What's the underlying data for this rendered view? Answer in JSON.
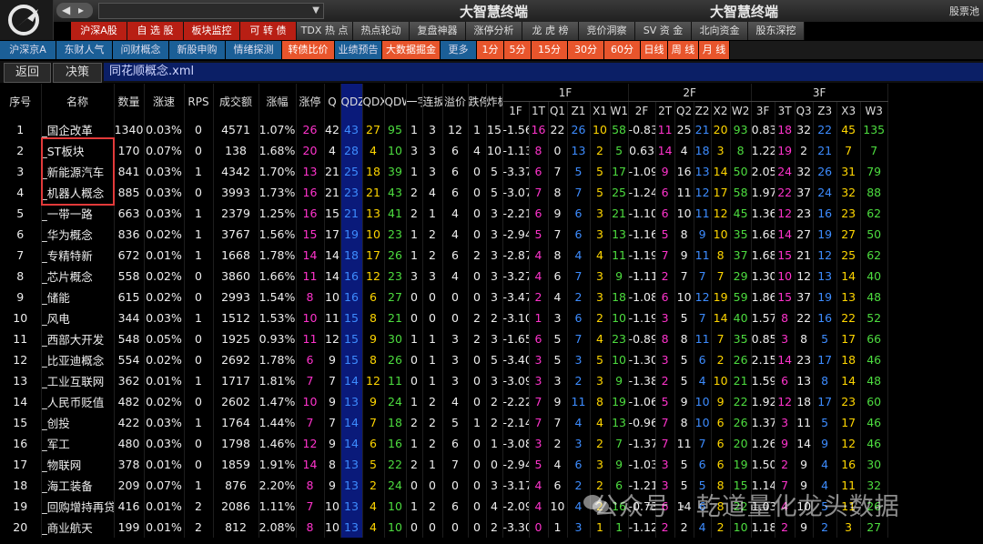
{
  "window": {
    "title_left": "大智慧终端",
    "title_right": "大智慧终端",
    "right_link": "股票池",
    "nav_arrows": "◀▸"
  },
  "main_menu": [
    {
      "label": "沪深A股",
      "style": "red"
    },
    {
      "label": "自 选 股",
      "style": "red"
    },
    {
      "label": "板块监控",
      "style": "red"
    },
    {
      "label": "可 转 债",
      "style": "red"
    },
    {
      "label": "TDX 热 点",
      "style": "gray"
    },
    {
      "label": "热点轮动",
      "style": "gray"
    },
    {
      "label": "复盘神器",
      "style": "gray"
    },
    {
      "label": "涨停分析",
      "style": "gray"
    },
    {
      "label": "龙 虎 榜",
      "style": "gray"
    },
    {
      "label": "竞价洞察",
      "style": "gray"
    },
    {
      "label": "SV 资 金",
      "style": "gray"
    },
    {
      "label": "北向资金",
      "style": "gray"
    },
    {
      "label": "股东深挖",
      "style": "gray"
    }
  ],
  "sub_menu": [
    {
      "label": "沪深京A",
      "style": "blue"
    },
    {
      "label": "东财人气",
      "style": "blue"
    },
    {
      "label": "问财概念",
      "style": "blue"
    },
    {
      "label": "新股申购",
      "style": "blue"
    },
    {
      "label": "情绪探测",
      "style": "blue"
    },
    {
      "label": "转债比价",
      "style": "orange"
    },
    {
      "label": "业绩预告",
      "style": "blue"
    },
    {
      "label": "大数据掘金",
      "style": "orange"
    },
    {
      "label": "更多",
      "style": "blue"
    },
    {
      "label": "1分",
      "style": "orange"
    },
    {
      "label": "5分",
      "style": "orange"
    },
    {
      "label": "15分",
      "style": "orange"
    },
    {
      "label": "30分",
      "style": "orange"
    },
    {
      "label": "60分",
      "style": "orange"
    },
    {
      "label": "日线",
      "style": "orange"
    },
    {
      "label": "周 线",
      "style": "orange"
    },
    {
      "label": "月 线",
      "style": "orange"
    }
  ],
  "breadcrumb": {
    "back": "返回",
    "decision": "决策",
    "file": "同花顺概念.xml"
  },
  "table": {
    "group_headers": [
      "1F",
      "2F",
      "3F"
    ],
    "columns": [
      "序号",
      "名称",
      "数量",
      "涨速",
      "RPS",
      "成交额",
      "涨幅",
      "涨停",
      "Q",
      "QDZ",
      "QDX",
      "QDW",
      "一字",
      "连扳",
      "溢价",
      "跌停",
      "炸板",
      "1F",
      "1T",
      "Q1",
      "Z1",
      "X1",
      "W1",
      "2F",
      "2T",
      "Q2",
      "Z2",
      "X2",
      "W2",
      "3F",
      "3T",
      "Q3",
      "Z3",
      "X3",
      "W3"
    ],
    "rows": [
      [
        "1",
        "_国企改革",
        "1340",
        "0.03%",
        "0",
        "4571",
        "1.07%",
        "26",
        "42",
        "43",
        "27",
        "95",
        "1",
        "3",
        "12",
        "1",
        "15",
        "-1.56",
        "16",
        "22",
        "26",
        "10",
        "58",
        "-0.83",
        "11",
        "25",
        "21",
        "20",
        "93",
        "0.83",
        "18",
        "32",
        "22",
        "45",
        "135"
      ],
      [
        "2",
        "_ST板块",
        "170",
        "0.07%",
        "0",
        "138",
        "1.68%",
        "20",
        "4",
        "28",
        "4",
        "10",
        "3",
        "3",
        "6",
        "4",
        "10",
        "-1.13",
        "8",
        "0",
        "13",
        "2",
        "5",
        "0.63",
        "14",
        "4",
        "18",
        "3",
        "8",
        "1.22",
        "19",
        "2",
        "21",
        "7",
        "7"
      ],
      [
        "3",
        "_新能源汽车",
        "841",
        "0.03%",
        "1",
        "4342",
        "1.70%",
        "13",
        "21",
        "25",
        "18",
        "39",
        "1",
        "3",
        "6",
        "0",
        "5",
        "-3.37",
        "6",
        "7",
        "5",
        "5",
        "17",
        "-1.09",
        "9",
        "16",
        "13",
        "14",
        "50",
        "2.05",
        "24",
        "32",
        "26",
        "31",
        "79"
      ],
      [
        "4",
        "_机器人概念",
        "885",
        "0.03%",
        "0",
        "3993",
        "1.73%",
        "16",
        "21",
        "23",
        "21",
        "43",
        "2",
        "4",
        "6",
        "0",
        "5",
        "-3.07",
        "7",
        "8",
        "7",
        "5",
        "25",
        "-1.24",
        "6",
        "11",
        "12",
        "17",
        "58",
        "1.97",
        "22",
        "37",
        "24",
        "32",
        "88"
      ],
      [
        "5",
        "_一带一路",
        "663",
        "0.03%",
        "1",
        "2379",
        "1.25%",
        "16",
        "15",
        "21",
        "13",
        "41",
        "2",
        "1",
        "4",
        "0",
        "3",
        "-2.21",
        "6",
        "9",
        "6",
        "3",
        "21",
        "-1.10",
        "6",
        "10",
        "11",
        "12",
        "45",
        "1.36",
        "12",
        "23",
        "16",
        "23",
        "62"
      ],
      [
        "6",
        "_华为概念",
        "836",
        "0.02%",
        "1",
        "3767",
        "1.56%",
        "15",
        "17",
        "19",
        "10",
        "23",
        "1",
        "2",
        "4",
        "0",
        "3",
        "-2.94",
        "5",
        "7",
        "6",
        "3",
        "13",
        "-1.16",
        "5",
        "8",
        "9",
        "10",
        "35",
        "1.68",
        "14",
        "27",
        "19",
        "27",
        "50"
      ],
      [
        "7",
        "_专精特新",
        "672",
        "0.01%",
        "1",
        "1668",
        "1.78%",
        "14",
        "14",
        "18",
        "17",
        "26",
        "1",
        "2",
        "6",
        "2",
        "3",
        "-2.87",
        "4",
        "8",
        "4",
        "4",
        "11",
        "-1.19",
        "7",
        "9",
        "11",
        "8",
        "37",
        "1.68",
        "15",
        "21",
        "12",
        "25",
        "62"
      ],
      [
        "8",
        "_芯片概念",
        "558",
        "0.02%",
        "0",
        "3860",
        "1.66%",
        "11",
        "14",
        "16",
        "12",
        "23",
        "3",
        "3",
        "4",
        "0",
        "3",
        "-3.27",
        "4",
        "6",
        "7",
        "3",
        "9",
        "-1.11",
        "2",
        "7",
        "7",
        "7",
        "29",
        "1.30",
        "10",
        "12",
        "13",
        "14",
        "40"
      ],
      [
        "9",
        "_储能",
        "615",
        "0.02%",
        "0",
        "2993",
        "1.54%",
        "8",
        "10",
        "16",
        "6",
        "27",
        "0",
        "0",
        "0",
        "0",
        "3",
        "-3.47",
        "2",
        "4",
        "2",
        "3",
        "18",
        "-1.08",
        "6",
        "10",
        "12",
        "19",
        "59",
        "1.86",
        "15",
        "37",
        "19",
        "13",
        "48"
      ],
      [
        "10",
        "_风电",
        "344",
        "0.03%",
        "1",
        "1512",
        "1.53%",
        "10",
        "11",
        "15",
        "8",
        "21",
        "0",
        "0",
        "0",
        "2",
        "2",
        "-3.10",
        "1",
        "3",
        "6",
        "2",
        "10",
        "-1.19",
        "3",
        "5",
        "7",
        "14",
        "40",
        "1.57",
        "8",
        "22",
        "16",
        "22",
        "52"
      ],
      [
        "11",
        "_西部大开发",
        "548",
        "0.05%",
        "0",
        "1925",
        "0.93%",
        "11",
        "12",
        "15",
        "9",
        "30",
        "1",
        "1",
        "3",
        "2",
        "3",
        "-1.65",
        "6",
        "5",
        "7",
        "4",
        "23",
        "-0.89",
        "8",
        "8",
        "11",
        "7",
        "35",
        "0.85",
        "3",
        "8",
        "5",
        "17",
        "66"
      ],
      [
        "12",
        "_比亚迪概念",
        "554",
        "0.02%",
        "0",
        "2692",
        "1.78%",
        "6",
        "9",
        "15",
        "8",
        "26",
        "0",
        "1",
        "3",
        "0",
        "5",
        "-3.40",
        "3",
        "5",
        "3",
        "5",
        "10",
        "-1.30",
        "3",
        "5",
        "6",
        "2",
        "26",
        "2.15",
        "14",
        "23",
        "17",
        "18",
        "46"
      ],
      [
        "13",
        "_工业互联网",
        "362",
        "0.01%",
        "1",
        "1717",
        "1.81%",
        "7",
        "7",
        "14",
        "12",
        "11",
        "0",
        "1",
        "3",
        "0",
        "3",
        "-3.09",
        "3",
        "3",
        "2",
        "3",
        "9",
        "-1.38",
        "2",
        "5",
        "4",
        "10",
        "21",
        "1.59",
        "6",
        "13",
        "8",
        "14",
        "48"
      ],
      [
        "14",
        "_人民币贬值",
        "482",
        "0.02%",
        "0",
        "2602",
        "1.47%",
        "10",
        "9",
        "13",
        "9",
        "24",
        "1",
        "2",
        "4",
        "0",
        "2",
        "-2.22",
        "7",
        "9",
        "11",
        "8",
        "19",
        "-1.06",
        "5",
        "9",
        "10",
        "9",
        "22",
        "1.92",
        "12",
        "18",
        "17",
        "23",
        "60"
      ],
      [
        "15",
        "_创投",
        "422",
        "0.03%",
        "1",
        "1764",
        "1.44%",
        "7",
        "7",
        "14",
        "7",
        "18",
        "2",
        "2",
        "5",
        "1",
        "2",
        "-2.14",
        "7",
        "7",
        "4",
        "4",
        "13",
        "-0.96",
        "7",
        "8",
        "10",
        "6",
        "26",
        "1.37",
        "3",
        "11",
        "5",
        "17",
        "46"
      ],
      [
        "16",
        "_军工",
        "480",
        "0.03%",
        "0",
        "1798",
        "1.46%",
        "12",
        "9",
        "14",
        "6",
        "16",
        "1",
        "2",
        "6",
        "0",
        "1",
        "-3.08",
        "3",
        "2",
        "3",
        "2",
        "7",
        "-1.37",
        "7",
        "11",
        "7",
        "6",
        "20",
        "1.26",
        "9",
        "14",
        "9",
        "12",
        "46"
      ],
      [
        "17",
        "_物联网",
        "378",
        "0.01%",
        "0",
        "1859",
        "1.91%",
        "14",
        "8",
        "13",
        "5",
        "22",
        "2",
        "1",
        "7",
        "0",
        "0",
        "-2.94",
        "5",
        "4",
        "6",
        "3",
        "9",
        "-1.03",
        "3",
        "5",
        "6",
        "6",
        "19",
        "1.50",
        "2",
        "9",
        "4",
        "16",
        "30"
      ],
      [
        "18",
        "_海工装备",
        "209",
        "0.07%",
        "1",
        "876",
        "2.20%",
        "8",
        "9",
        "13",
        "2",
        "24",
        "0",
        "0",
        "0",
        "0",
        "3",
        "-3.17",
        "4",
        "6",
        "2",
        "2",
        "6",
        "-1.21",
        "3",
        "5",
        "5",
        "8",
        "15",
        "1.14",
        "7",
        "9",
        "4",
        "11",
        "32"
      ],
      [
        "19",
        "_回购增持再贷",
        "416",
        "0.01%",
        "2",
        "2086",
        "1.11%",
        "7",
        "10",
        "13",
        "4",
        "10",
        "1",
        "2",
        "6",
        "0",
        "4",
        "-2.09",
        "4",
        "10",
        "4",
        "2",
        "16",
        "-0.73",
        "6",
        "14",
        "6",
        "8",
        "22",
        "1.03",
        "4",
        "10",
        "5",
        "11",
        "26"
      ],
      [
        "20",
        "_商业航天",
        "199",
        "0.01%",
        "2",
        "812",
        "2.08%",
        "8",
        "10",
        "13",
        "4",
        "10",
        "0",
        "0",
        "0",
        "0",
        "2",
        "-3.30",
        "0",
        "1",
        "3",
        "1",
        "1",
        "-1.12",
        "2",
        "2",
        "4",
        "2",
        "10",
        "1.18",
        "2",
        "9",
        "2",
        "3",
        "27"
      ]
    ]
  },
  "watermark": "公众号 · 乾道量化龙头数据",
  "colors": {
    "accent_red": "#b81f14",
    "accent_orange": "#e8552c",
    "accent_blue": "#1b5f97",
    "qdz_bg": "#0a1a7a",
    "highlight_box": "#e23a3a"
  }
}
